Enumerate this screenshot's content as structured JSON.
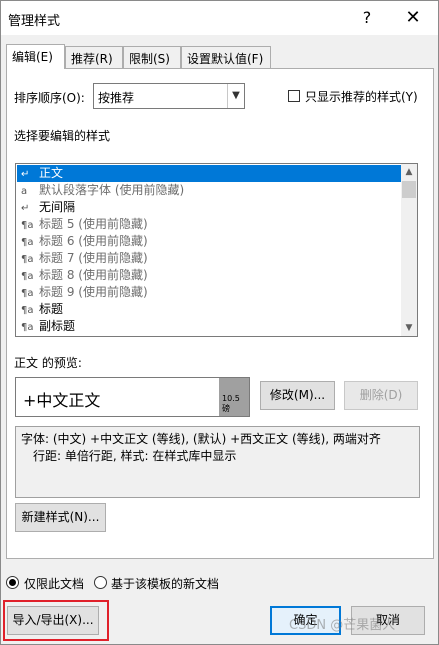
{
  "title": "管理样式",
  "titlebar": {
    "help": "?",
    "close": "✕"
  },
  "tabs": [
    "编辑(E)",
    "推荐(R)",
    "限制(S)",
    "设置默认值(F)"
  ],
  "sort": {
    "label": "排序顺序(O):",
    "value": "按推荐"
  },
  "only_recommended": {
    "label": "只显示推荐的样式(Y)",
    "checked": false
  },
  "select_label": "选择要编辑的样式",
  "styles": [
    {
      "icon": "↵",
      "label": "正文",
      "selected": true,
      "dim": false
    },
    {
      "icon": "a",
      "label": "默认段落字体  (使用前隐藏)",
      "selected": false,
      "dim": true
    },
    {
      "icon": "↵",
      "label": "无间隔",
      "selected": false,
      "dim": false
    },
    {
      "icon": "¶a",
      "label": "标题 5  (使用前隐藏)",
      "selected": false,
      "dim": true
    },
    {
      "icon": "¶a",
      "label": "标题 6  (使用前隐藏)",
      "selected": false,
      "dim": true
    },
    {
      "icon": "¶a",
      "label": "标题 7  (使用前隐藏)",
      "selected": false,
      "dim": true
    },
    {
      "icon": "¶a",
      "label": "标题 8  (使用前隐藏)",
      "selected": false,
      "dim": true
    },
    {
      "icon": "¶a",
      "label": "标题 9  (使用前隐藏)",
      "selected": false,
      "dim": true
    },
    {
      "icon": "¶a",
      "label": "标题",
      "selected": false,
      "dim": false
    },
    {
      "icon": "¶a",
      "label": "副标题",
      "selected": false,
      "dim": false
    }
  ],
  "preview": {
    "label": "正文 的预览:",
    "text": "+中文正文",
    "size": "10.5 磅"
  },
  "buttons": {
    "modify": "修改(M)...",
    "delete": "删除(D)",
    "new_style": "新建样式(N)...",
    "import_export": "导入/导出(X)...",
    "ok": "确定",
    "cancel": "取消"
  },
  "description": {
    "line1": "字体: (中文) +中文正文 (等线), (默认) +西文正文 (等线), 两端对齐",
    "line2": "行距: 单倍行距, 样式: 在样式库中显示"
  },
  "scope": {
    "option1": "仅限此文档",
    "option2": "基于该模板的新文档",
    "selected": "option1"
  },
  "watermark": "CSDN @芒果菌人"
}
